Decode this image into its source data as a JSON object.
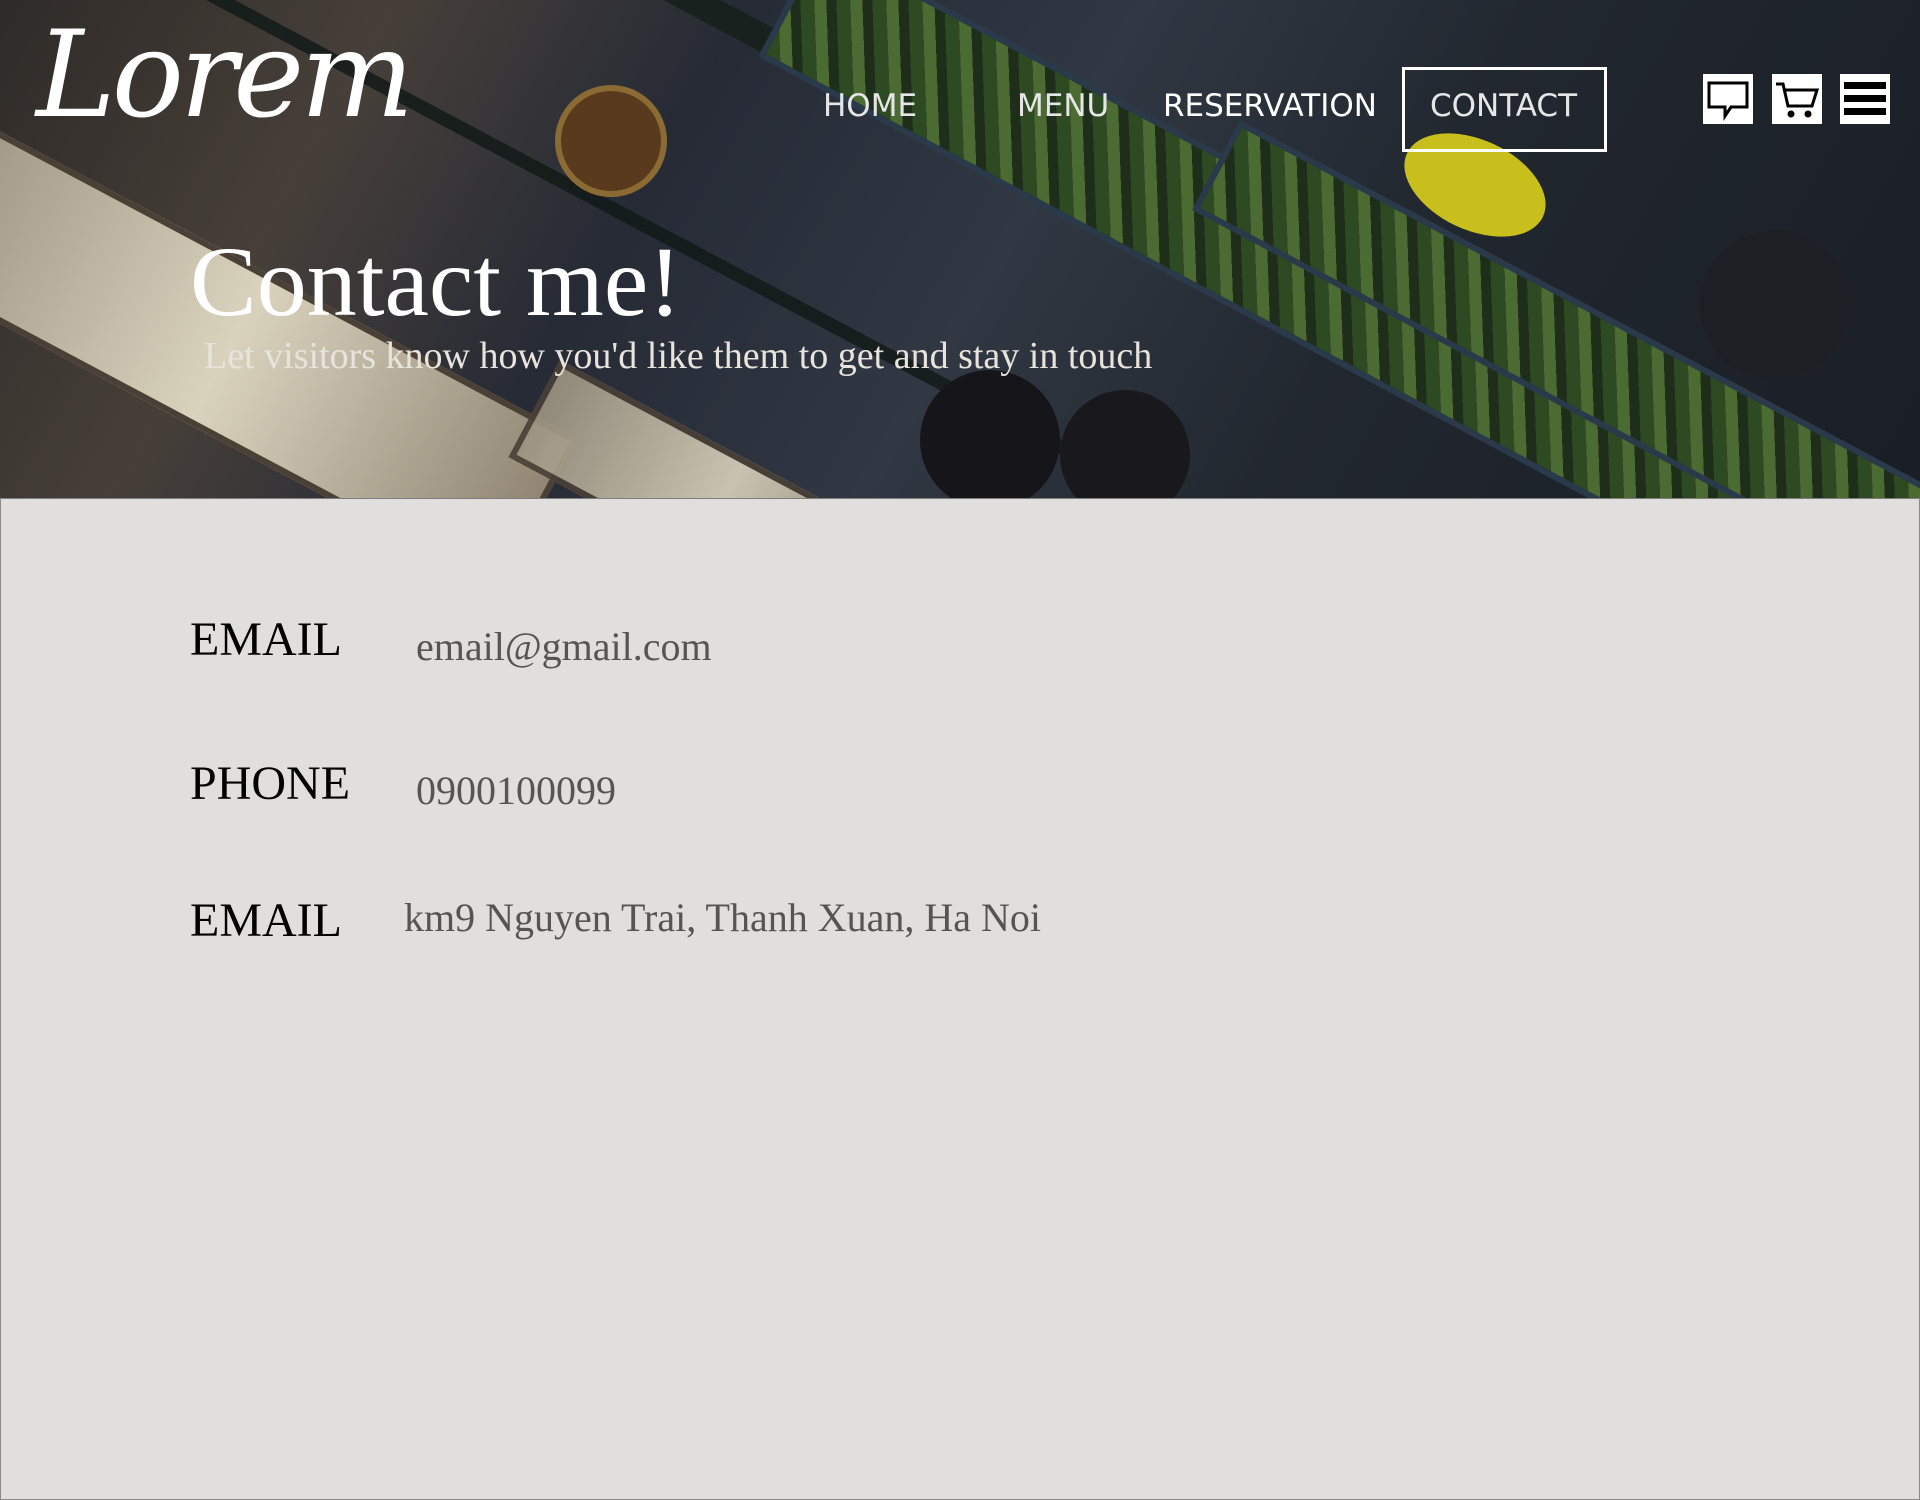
{
  "brand": {
    "logo": "Lorem"
  },
  "nav": {
    "items": [
      "HOME",
      "MENU",
      "RESERVATION",
      "CONTACT"
    ],
    "active": "CONTACT"
  },
  "header_icons": [
    "chat-icon",
    "cart-icon",
    "hamburger-menu-icon"
  ],
  "hero": {
    "title": "Contact me!",
    "subtitle": "Let visitors know how you'd like them to get and stay in touch"
  },
  "contact": {
    "rows": [
      {
        "label": "EMAIL",
        "value": "email@gmail.com"
      },
      {
        "label": "PHONE",
        "value": "0900100099"
      },
      {
        "label": "EMAIL",
        "value": "km9 Nguyen Trai, Thanh Xuan, Ha Noi"
      }
    ]
  },
  "colors": {
    "content_background": "#e1dede",
    "label_text": "#000000",
    "value_text": "#555555",
    "nav_text": "#e6e6e6"
  }
}
